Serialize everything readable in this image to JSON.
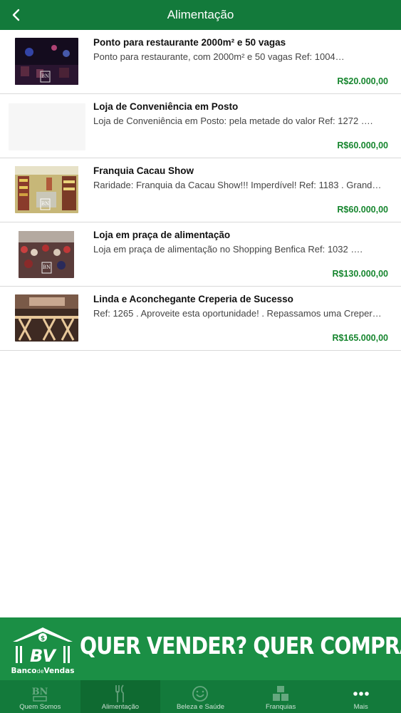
{
  "header": {
    "title": "Alimentação",
    "back_icon": "chevron-left-icon"
  },
  "colors": {
    "brand_green": "#137a3b",
    "price_green": "#17862f",
    "banner_green": "#1b8f45"
  },
  "listings": [
    {
      "title": "Ponto para restaurante 2000m² e 50 vagas",
      "description": "Ponto para restaurante, com 2000m² e 50 vagas Ref: 1004…",
      "price": "R$20.000,00"
    },
    {
      "title": "Loja de Conveniência em Posto",
      "description": "Loja de Conveniência em Posto: pela metade do valor Ref: 1272 ….",
      "price": "R$60.000,00"
    },
    {
      "title": "Franquia Cacau Show",
      "description": "Raridade: Franquia da Cacau Show!!! Imperdível! Ref: 1183 . Grand…",
      "price": "R$60.000,00"
    },
    {
      "title": "Loja em praça de alimentação",
      "description": "Loja em praça de alimentação no Shopping Benfica Ref: 1032 ….",
      "price": "R$130.000,00"
    },
    {
      "title": "Linda e Aconchegante Creperia de Sucesso",
      "description": "Ref: 1265 . Aproveite esta oportunidade! . Repassamos uma Creper…",
      "price": "R$165.000,00"
    }
  ],
  "banner": {
    "logo_letters": "BV",
    "logo_text_a": "Banco",
    "logo_text_b": "de",
    "logo_text_c": "Vendas",
    "slogan": "QUER VENDER? QUER COMPRAR?"
  },
  "tabs": [
    {
      "label": "Quem Somos",
      "icon": "bn-logo-icon"
    },
    {
      "label": "Alimentação",
      "icon": "fork-knife-icon"
    },
    {
      "label": "Beleza e Saúde",
      "icon": "beauty-icon"
    },
    {
      "label": "Franquias",
      "icon": "boxes-icon"
    },
    {
      "label": "Mais",
      "icon": "more-dots-icon"
    }
  ]
}
